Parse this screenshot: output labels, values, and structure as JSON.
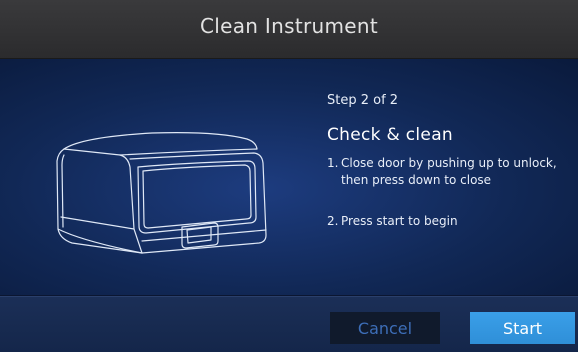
{
  "header": {
    "title": "Clean Instrument"
  },
  "step": {
    "label": "Step 2 of 2",
    "heading": "Check & clean",
    "instructions": [
      {
        "number": "1.",
        "text": "Close door by pushing up to unlock, then press down to close"
      },
      {
        "number": "2.",
        "text": "Press start to begin"
      }
    ]
  },
  "footer": {
    "cancel_label": "Cancel",
    "start_label": "Start"
  },
  "colors": {
    "header_bg": "#2f2f31",
    "content_bg": "#14306a",
    "start_button": "#3596e0",
    "cancel_text": "#3d6eb8"
  },
  "icons": {
    "illustration": "instrument-line-drawing"
  }
}
